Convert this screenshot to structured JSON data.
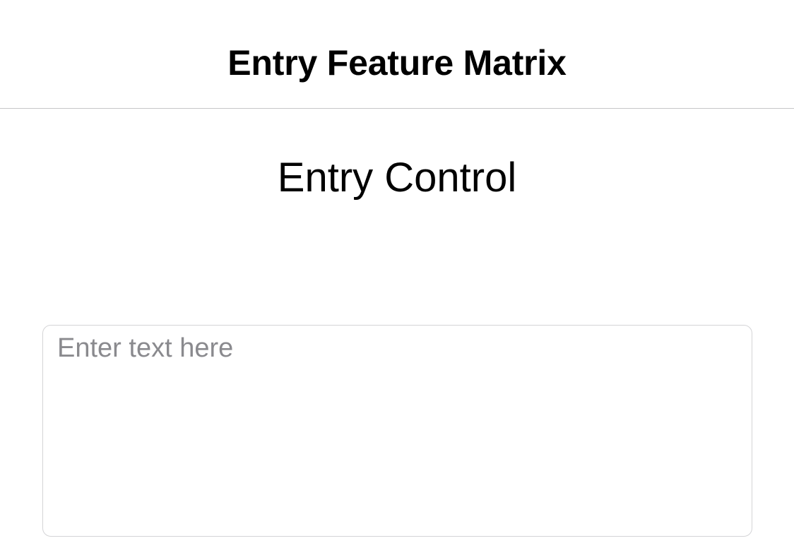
{
  "nav": {
    "title": "Entry Feature Matrix"
  },
  "section": {
    "title": "Entry Control"
  },
  "entry": {
    "value": "",
    "placeholder": "Enter text here"
  },
  "colors": {
    "background": "#ffffff",
    "divider": "#c6c6c8",
    "entry_border": "#d4d4d6",
    "placeholder": "#8a8a8e",
    "text": "#000000"
  }
}
